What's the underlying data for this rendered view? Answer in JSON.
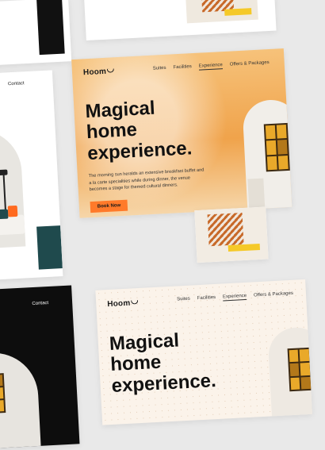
{
  "cards": {
    "second": {
      "brand": "Hoom",
      "nav": [
        "Suites",
        "Facilities",
        "Experience",
        "Offers & Packages"
      ],
      "active_nav": "Experience",
      "headline": [
        "Magical",
        "home",
        "experience."
      ],
      "paragraph": "The morning sun heralds an extensive breakfast buffet and a la carte specialities while during dinner, the venue becomes a stage for themed cultural dinners.",
      "button": "Book Now"
    },
    "contact_top": "Contact",
    "contact_bottom": "Contact",
    "fourth": {
      "brand": "Hoom",
      "nav": [
        "Suites",
        "Facilities",
        "Experience",
        "Offers & Packages"
      ],
      "active_nav": "Experience",
      "headline": [
        "Magical",
        "home",
        "experience."
      ]
    }
  },
  "colors": {
    "accent": "#ff7a2a",
    "dark": "#111111",
    "teal": "#1f4a4d"
  }
}
